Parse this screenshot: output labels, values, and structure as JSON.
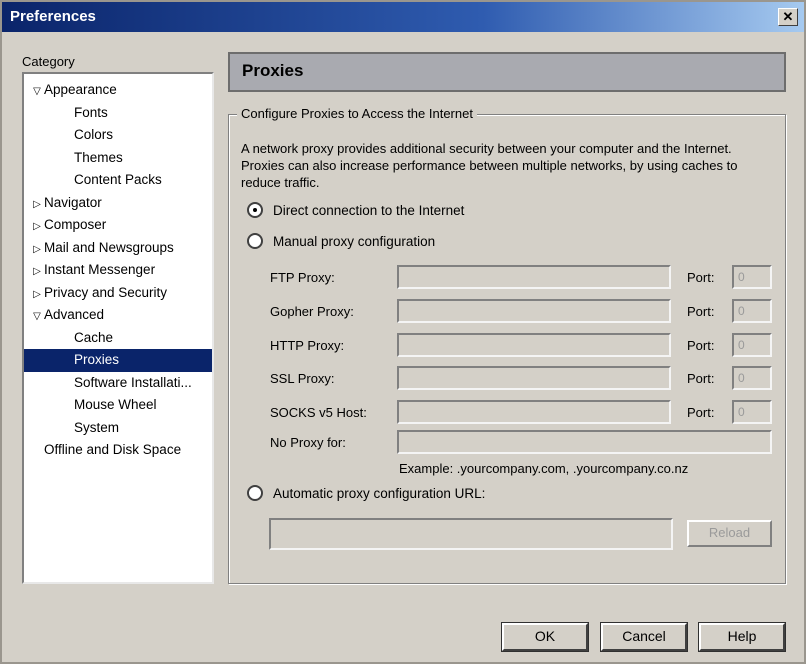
{
  "window": {
    "title": "Preferences",
    "close_glyph": "✕"
  },
  "category": {
    "label": "Category",
    "items": [
      {
        "label": "Appearance",
        "level": 0,
        "twisty": "▽"
      },
      {
        "label": "Fonts",
        "level": 1
      },
      {
        "label": "Colors",
        "level": 1
      },
      {
        "label": "Themes",
        "level": 1
      },
      {
        "label": "Content Packs",
        "level": 1
      },
      {
        "label": "Navigator",
        "level": 0,
        "twisty": "▷"
      },
      {
        "label": "Composer",
        "level": 0,
        "twisty": "▷"
      },
      {
        "label": "Mail and Newsgroups",
        "level": 0,
        "twisty": "▷"
      },
      {
        "label": "Instant Messenger",
        "level": 0,
        "twisty": "▷"
      },
      {
        "label": "Privacy and Security",
        "level": 0,
        "twisty": "▷"
      },
      {
        "label": "Advanced",
        "level": 0,
        "twisty": "▽"
      },
      {
        "label": "Cache",
        "level": 1
      },
      {
        "label": "Proxies",
        "level": 1,
        "selected": true
      },
      {
        "label": "Software Installati...",
        "level": 1
      },
      {
        "label": "Mouse Wheel",
        "level": 1
      },
      {
        "label": "System",
        "level": 1
      },
      {
        "label": "Offline and Disk Space",
        "level": 0
      }
    ]
  },
  "panel": {
    "title": "Proxies",
    "group_title": "Configure Proxies to Access the Internet",
    "description": "A network proxy provides additional security between your computer and the Internet. Proxies can also increase performance between multiple networks, by using caches to reduce traffic.",
    "radio_direct": "Direct connection to the Internet",
    "radio_manual": "Manual proxy configuration",
    "radio_auto": "Automatic proxy configuration URL:",
    "selected_radio": "direct",
    "proxies": [
      {
        "label": "FTP Proxy:",
        "port_label": "Port:",
        "port": "0"
      },
      {
        "label": "Gopher Proxy:",
        "port_label": "Port:",
        "port": "0"
      },
      {
        "label": "HTTP Proxy:",
        "port_label": "Port:",
        "port": "0"
      },
      {
        "label": "SSL Proxy:",
        "port_label": "Port:",
        "port": "0"
      },
      {
        "label": "SOCKS v5 Host:",
        "port_label": "Port:",
        "port": "0"
      }
    ],
    "no_proxy_label": "No Proxy for:",
    "no_proxy_value": "",
    "example": "Example: .yourcompany.com, .yourcompany.co.nz",
    "auto_url_value": "",
    "reload_label": "Reload"
  },
  "buttons": {
    "ok": "OK",
    "cancel": "Cancel",
    "help": "Help"
  }
}
